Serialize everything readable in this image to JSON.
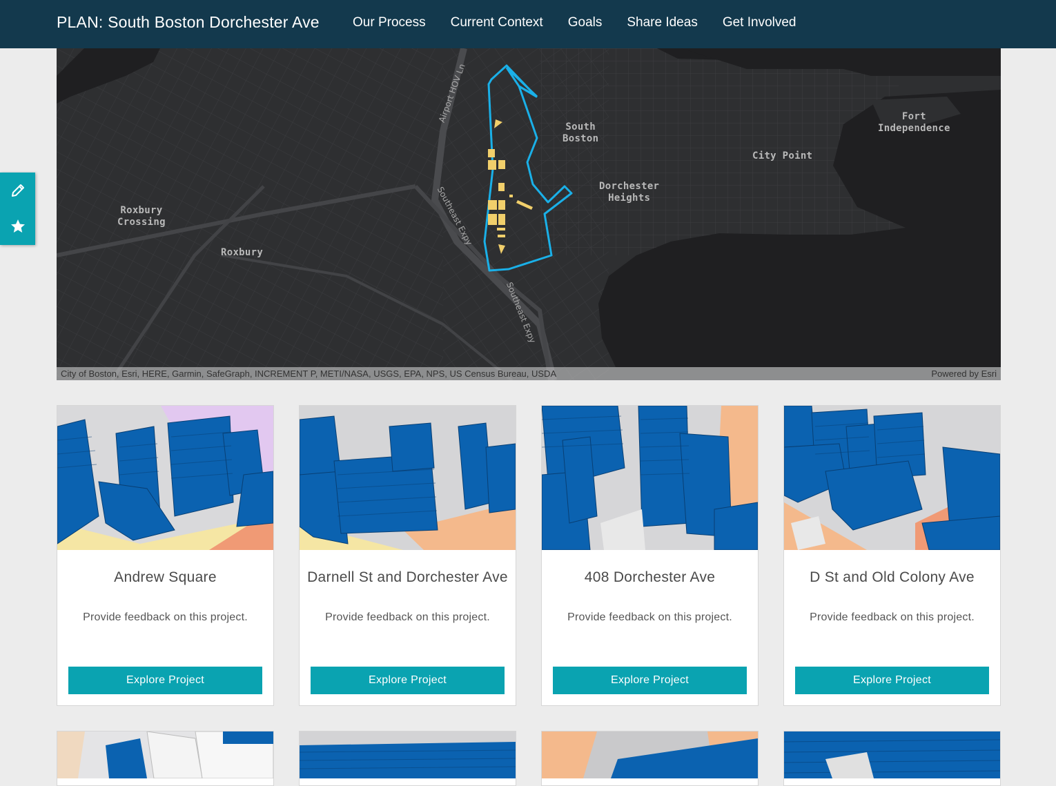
{
  "header": {
    "title": "PLAN: South Boston Dorchester Ave",
    "nav": [
      "Our Process",
      "Current Context",
      "Goals",
      "Share Ideas",
      "Get Involved"
    ]
  },
  "map": {
    "labels": {
      "south_boston": "South\nBoston",
      "fort_independence": "Fort\nIndependence",
      "city_point": "City Point",
      "dorchester_heights": "Dorchester\nHeights",
      "roxbury_crossing": "Roxbury\nCrossing",
      "roxbury": "Roxbury"
    },
    "roads": {
      "airport_hov": "Airport HOV Ln",
      "southeast_expy_1": "Southeast Expy",
      "southeast_expy_2": "Southeast Expy"
    },
    "attribution": "City of Boston, Esri, HERE, Garmin, SafeGraph, INCREMENT P, METI/NASA, USGS, EPA, NPS, US Census Bureau, USDA",
    "powered_by": "Powered by Esri",
    "colors": {
      "boundary": "#1ab0e8",
      "parcels": "#f1cf6b",
      "water": "#1f1f21",
      "land": "#2e2f31"
    }
  },
  "side_tools": {
    "icons": [
      "pencil-icon",
      "star-icon"
    ]
  },
  "cards": [
    {
      "title": "Andrew Square",
      "desc": "Provide feedback on this project.",
      "button": "Explore Project"
    },
    {
      "title": "Darnell St and Dorchester Ave",
      "desc": "Provide feedback on this project.",
      "button": "Explore Project"
    },
    {
      "title": "408 Dorchester Ave",
      "desc": "Provide feedback on this project.",
      "button": "Explore Project"
    },
    {
      "title": "D St and Old Colony Ave",
      "desc": "Provide feedback on this project.",
      "button": "Explore Project"
    }
  ],
  "colors": {
    "header_bg": "#13394d",
    "accent": "#0aa3b1",
    "building_blue": "#0b62b0"
  }
}
